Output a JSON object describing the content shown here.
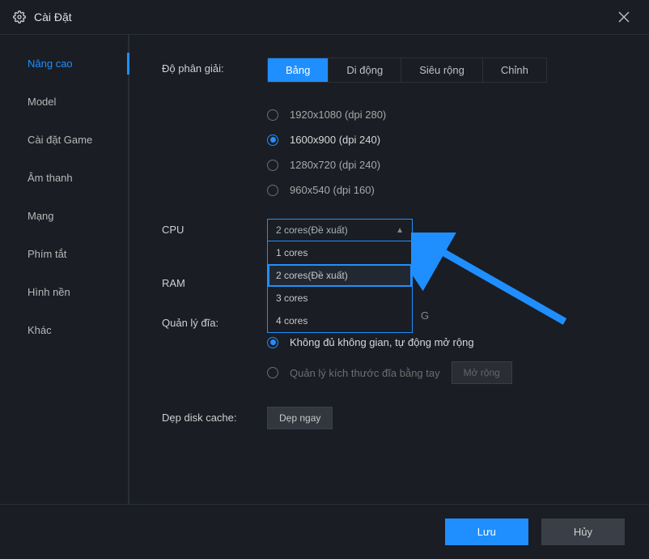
{
  "title": "Cài Đặt",
  "sidebar": {
    "items": [
      {
        "label": "Nâng cao"
      },
      {
        "label": "Model"
      },
      {
        "label": "Cài đặt Game"
      },
      {
        "label": "Âm thanh"
      },
      {
        "label": "Mạng"
      },
      {
        "label": "Phím tắt"
      },
      {
        "label": "Hình nền"
      },
      {
        "label": "Khác"
      }
    ],
    "active_index": 0
  },
  "resolution": {
    "label": "Độ phân giải:",
    "tabs": [
      "Bảng",
      "Di động",
      "Siêu rộng",
      "Chỉnh"
    ],
    "active_tab": 0,
    "options": [
      "1920x1080  (dpi 280)",
      "1600x900  (dpi 240)",
      "1280x720  (dpi 240)",
      "960x540  (dpi 160)"
    ],
    "selected_option": 1
  },
  "cpu": {
    "label": "CPU",
    "value": "2 cores(Đề xuất)",
    "options": [
      "1 cores",
      "2 cores(Đề xuất)",
      "3 cores",
      "4 cores"
    ],
    "highlight_index": 1
  },
  "ram": {
    "label": "RAM"
  },
  "disk": {
    "label": "Quản lý đĩa:",
    "trailing": "G",
    "opts": [
      "Không đủ không gian, tự động mở rộng",
      "Quản lý kích thước đĩa bằng tay"
    ],
    "selected": 0,
    "expand_btn": "Mở rộng"
  },
  "cache": {
    "label": "Dẹp disk cache:",
    "btn": "Dẹp ngay"
  },
  "footer": {
    "save": "Lưu",
    "cancel": "Hủy"
  }
}
